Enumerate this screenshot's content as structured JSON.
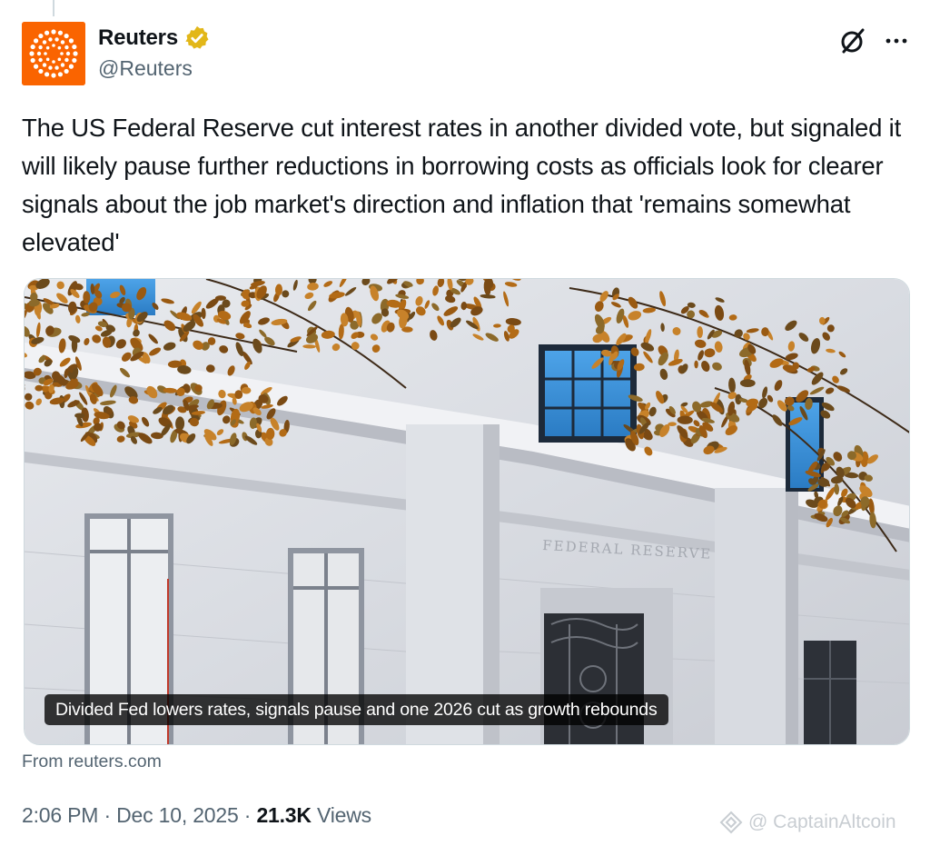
{
  "tweet": {
    "author_name": "Reuters",
    "author_handle": "@Reuters",
    "verified_badge_color": "#E2B719",
    "brand_color": "#FA6400",
    "text": "The US Federal Reserve cut interest rates in another divided vote, but signaled it will likely pause further reductions in borrowing costs as officials look for clearer signals about the job market's direction and inflation that 'remains somewhat elevated'",
    "card": {
      "caption": "Divided Fed lowers rates, signals pause and one 2026 cut as growth rebounds",
      "building_inscription": "FEDERAL RESERVE",
      "source": "From reuters.com"
    },
    "meta": {
      "time": "2:06 PM",
      "separator": "·",
      "date": "Dec 10, 2025",
      "views_count": "21.3K",
      "views_label": "Views"
    },
    "icons": {
      "grok": "grok-icon",
      "more": "more-icon",
      "verified": "verified-badge-icon",
      "logo": "reuters-logo"
    }
  },
  "watermark": {
    "text": "@ CaptainAltcoin"
  }
}
